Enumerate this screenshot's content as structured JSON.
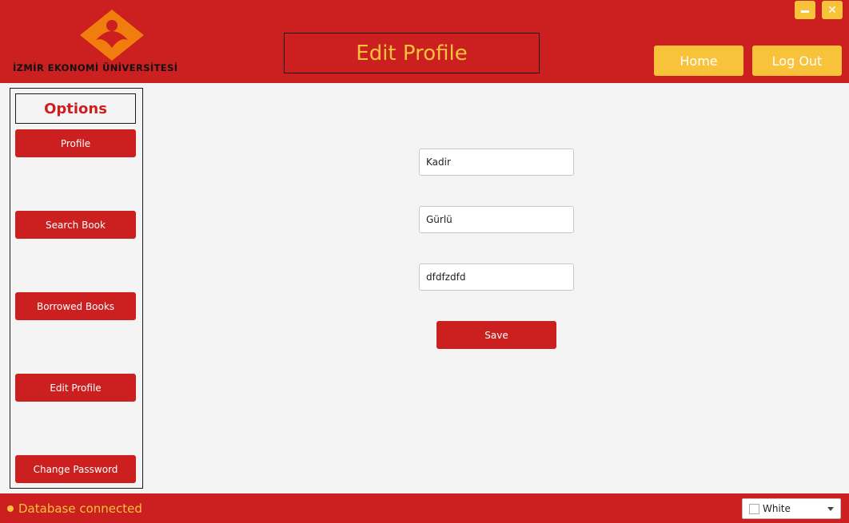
{
  "header": {
    "logo_text": "İZMİR EKONOMİ ÜNİVERSİTESİ",
    "title": "Edit Profile",
    "home_label": "Home",
    "logout_label": "Log Out",
    "minimize_icon": "minimize-icon",
    "close_icon": "close-icon"
  },
  "sidebar": {
    "heading": "Options",
    "items": [
      {
        "label": "Profile"
      },
      {
        "label": "Search Book"
      },
      {
        "label": "Borrowed Books"
      },
      {
        "label": "Edit Profile"
      },
      {
        "label": "Change Password"
      }
    ]
  },
  "form": {
    "first_name": "Kadir",
    "last_name": "Gürlü",
    "third_field": "dfdfzdfd",
    "save_label": "Save"
  },
  "footer": {
    "status": "Database connected",
    "theme_value": "White"
  },
  "colors": {
    "primary_red": "#cc1f1f",
    "accent_yellow": "#f8c23a",
    "logo_orange": "#f07d0e"
  }
}
